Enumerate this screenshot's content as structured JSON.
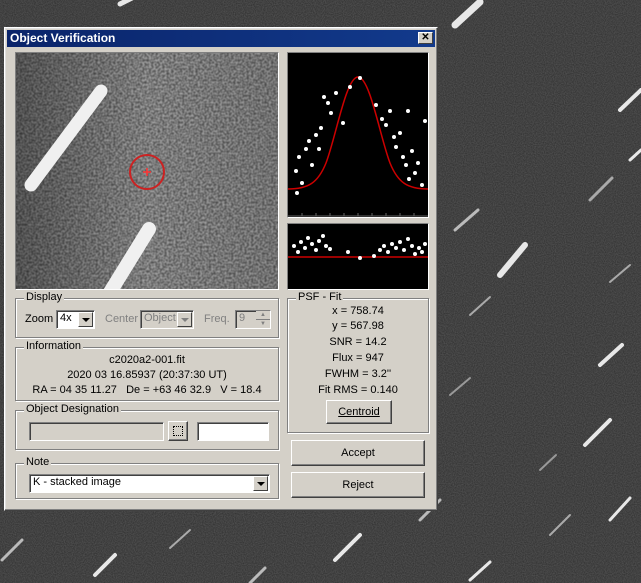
{
  "window": {
    "title": "Object Verification",
    "close_glyph": "✕"
  },
  "display": {
    "legend": "Display",
    "zoom_label": "Zoom",
    "zoom_value": "4x",
    "center_label": "Center",
    "center_value": "Object",
    "freq_label": "Freq.",
    "freq_value": "9"
  },
  "information": {
    "legend": "Information",
    "filename": "c2020a2-001.fit",
    "datetime": "2020 03 16.85937 (20:37:30 UT)",
    "coords": "RA = 04 35 11.27   De = +63 46 32.9   V = 18.4"
  },
  "designation": {
    "legend": "Object Designation",
    "value": "",
    "value2": ""
  },
  "note": {
    "legend": "Note",
    "value": "K - stacked image"
  },
  "psf": {
    "legend": "PSF - Fit",
    "x": "x = 758.74",
    "y": "y = 567.98",
    "snr": "SNR = 14.2",
    "flux": "Flux = 947",
    "fwhm": "FWHM = 3.2''",
    "fit_rms": "Fit RMS = 0.140"
  },
  "buttons": {
    "centroid": "Centroid",
    "accept": "Accept",
    "reject": "Reject"
  },
  "colors": {
    "titlebar": "#0a246a",
    "fit_curve": "#cc0000",
    "marker": "#cc2222"
  }
}
